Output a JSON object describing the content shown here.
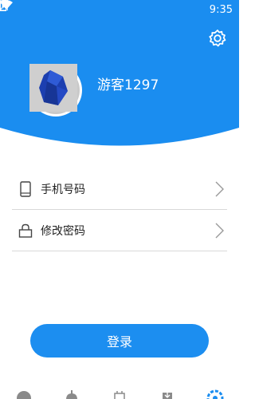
{
  "status_bar": {
    "time": "9:35"
  },
  "profile": {
    "username": "游客1297"
  },
  "menu": {
    "items": [
      {
        "label": "手机号码",
        "icon": "phone-icon"
      },
      {
        "label": "修改密码",
        "icon": "lock-icon"
      }
    ]
  },
  "login_button": {
    "label": "登录"
  },
  "tabs": [
    {
      "icon": "home-icon"
    },
    {
      "icon": "game-icon"
    },
    {
      "icon": "gift-icon"
    },
    {
      "icon": "download-icon"
    },
    {
      "icon": "settings-icon",
      "active": true
    }
  ],
  "colors": {
    "primary": "#1c8ef0",
    "header": "#1a8df0",
    "divider": "#d9d9d9"
  }
}
